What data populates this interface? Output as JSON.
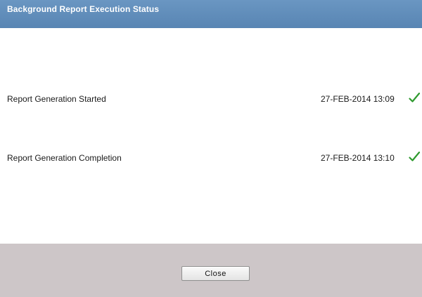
{
  "dialog": {
    "title": "Background Report Execution Status"
  },
  "status_rows": [
    {
      "label": "Report Generation Started",
      "timestamp": "27-FEB-2014 13:09",
      "status_icon": "checkmark-icon"
    },
    {
      "label": "Report Generation Completion",
      "timestamp": "27-FEB-2014 13:10",
      "status_icon": "checkmark-icon"
    }
  ],
  "footer": {
    "close_label": "Close"
  },
  "colors": {
    "title_bar": "#5f8cba",
    "footer": "#cdc6c8",
    "check": "#2f9a2f"
  }
}
